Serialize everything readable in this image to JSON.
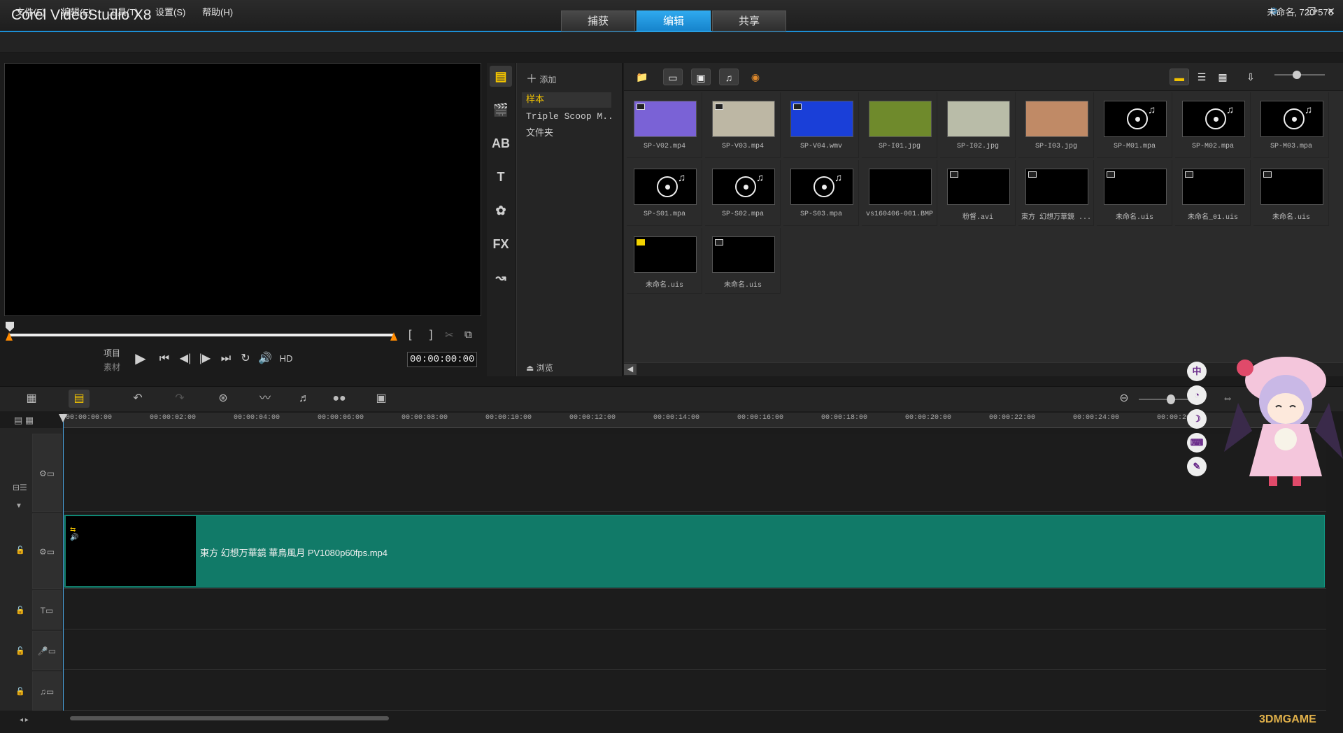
{
  "window": {
    "title": "Corel VideoStudio X8",
    "project_info": "未命名, 720*576"
  },
  "mode_tabs": [
    "捕获",
    "编辑",
    "共享"
  ],
  "active_mode": "编辑",
  "menu": [
    "文件(F)",
    "编辑(E)",
    "工具(T)",
    "设置(S)",
    "帮助(H)"
  ],
  "player": {
    "mode_project": "项目",
    "mode_clip": "素材",
    "hd": "HD",
    "timecode": "00:00:00:00",
    "mark_in": "[",
    "mark_out": "]"
  },
  "library": {
    "add_label": "添加",
    "browse_label": "浏览",
    "folders": [
      "样本",
      "Triple Scoop M...",
      "文件夹"
    ],
    "items": [
      {
        "name": "SP-V02.mp4",
        "kind": "video",
        "color": "#7a62d6"
      },
      {
        "name": "SP-V03.mp4",
        "kind": "video",
        "color": "#bdb7a4"
      },
      {
        "name": "SP-V04.wmv",
        "kind": "video",
        "color": "#1a3fd8"
      },
      {
        "name": "SP-I01.jpg",
        "kind": "image",
        "color": "#6f8a2c"
      },
      {
        "name": "SP-I02.jpg",
        "kind": "image",
        "color": "#b9bca8"
      },
      {
        "name": "SP-I03.jpg",
        "kind": "image",
        "color": "#c08a66"
      },
      {
        "name": "SP-M01.mpa",
        "kind": "audio",
        "color": "#000000"
      },
      {
        "name": "SP-M02.mpa",
        "kind": "audio",
        "color": "#000000"
      },
      {
        "name": "SP-M03.mpa",
        "kind": "audio",
        "color": "#000000"
      },
      {
        "name": "SP-S01.mpa",
        "kind": "audio",
        "color": "#000000"
      },
      {
        "name": "SP-S02.mpa",
        "kind": "audio",
        "color": "#000000"
      },
      {
        "name": "SP-S03.mpa",
        "kind": "audio",
        "color": "#000000"
      },
      {
        "name": "vs160406-001.BMP",
        "kind": "image",
        "color": "#000000"
      },
      {
        "name": "粉督.avi",
        "kind": "video",
        "color": "#000000"
      },
      {
        "name": "東方 幻想万華鏡 ...",
        "kind": "video",
        "color": "#000000"
      },
      {
        "name": "未命名.uis",
        "kind": "video",
        "color": "#000000"
      },
      {
        "name": "未命名_01.uis",
        "kind": "video",
        "color": "#000000"
      },
      {
        "name": "未命名.uis",
        "kind": "video",
        "color": "#000000"
      },
      {
        "name": "未命名.uis",
        "kind": "project",
        "color": "#000000"
      },
      {
        "name": "未命名.uis",
        "kind": "video",
        "color": "#000000"
      }
    ]
  },
  "timeline": {
    "ticks": [
      "00:00:00:00",
      "00:00:02:00",
      "00:00:04:00",
      "00:00:06:00",
      "00:00:08:00",
      "00:00:10:00",
      "00:00:12:00",
      "00:00:14:00",
      "00:00:16:00",
      "00:00:18:00",
      "00:00:20:00",
      "00:00:22:00",
      "00:00:24:00",
      "00:00:26:"
    ],
    "clip_label": "東方 幻想万華鏡 華鳥風月 PV1080p60fps.mp4",
    "scale_label": "+/-"
  },
  "ime": [
    "中"
  ],
  "watermark": "3DMGAME"
}
